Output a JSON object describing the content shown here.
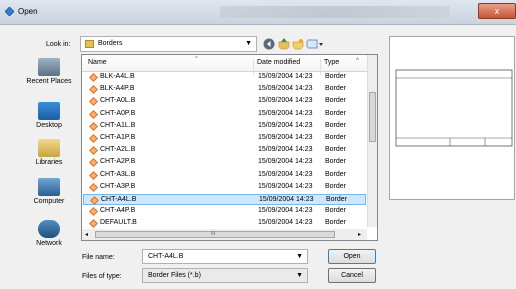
{
  "window": {
    "title": "Open",
    "close_label": "x"
  },
  "look_in": {
    "label": "Look in:",
    "value": "Borders"
  },
  "places": [
    "Recent Places",
    "Desktop",
    "Libraries",
    "Computer",
    "Network"
  ],
  "columns": {
    "name": "Name",
    "date": "Date modified",
    "type": "Type",
    "sort_glyph": "^"
  },
  "files": [
    {
      "name": "BLK-A4L.B",
      "date": "15/09/2004 14:23",
      "type": "Border"
    },
    {
      "name": "BLK-A4P.B",
      "date": "15/09/2004 14:23",
      "type": "Border"
    },
    {
      "name": "CHT-A0L.B",
      "date": "15/09/2004 14:23",
      "type": "Border"
    },
    {
      "name": "CHT-A0P.B",
      "date": "15/09/2004 14:23",
      "type": "Border"
    },
    {
      "name": "CHT-A1L.B",
      "date": "15/09/2004 14:23",
      "type": "Border"
    },
    {
      "name": "CHT-A1P.B",
      "date": "15/09/2004 14:23",
      "type": "Border"
    },
    {
      "name": "CHT-A2L.B",
      "date": "15/09/2004 14:23",
      "type": "Border"
    },
    {
      "name": "CHT-A2P.B",
      "date": "15/09/2004 14:23",
      "type": "Border"
    },
    {
      "name": "CHT-A3L.B",
      "date": "15/09/2004 14:23",
      "type": "Border"
    },
    {
      "name": "CHT-A3P.B",
      "date": "15/09/2004 14:23",
      "type": "Border"
    },
    {
      "name": "CHT-A4L.B",
      "date": "15/09/2004 14:23",
      "type": "Border",
      "selected": true
    },
    {
      "name": "CHT-A4P.B",
      "date": "15/09/2004 14:23",
      "type": "Border"
    },
    {
      "name": "DEFAULT.B",
      "date": "15/09/2004 14:23",
      "type": "Border"
    }
  ],
  "file_name": {
    "label": "File name:",
    "value": "CHT-A4L.B"
  },
  "file_type": {
    "label": "Files of type:",
    "value": "Border Files (*.b)"
  },
  "buttons": {
    "open": "Open",
    "cancel": "Cancel"
  },
  "hscroll_glyph": "III",
  "colors": {
    "selection": "#cce8ff",
    "file_icon": "#e8772a",
    "accent": "#3c7fb1"
  },
  "icons": [
    "back-icon",
    "up-folder-icon",
    "new-folder-icon",
    "view-menu-icon",
    "folder-icon",
    "file-icon"
  ]
}
